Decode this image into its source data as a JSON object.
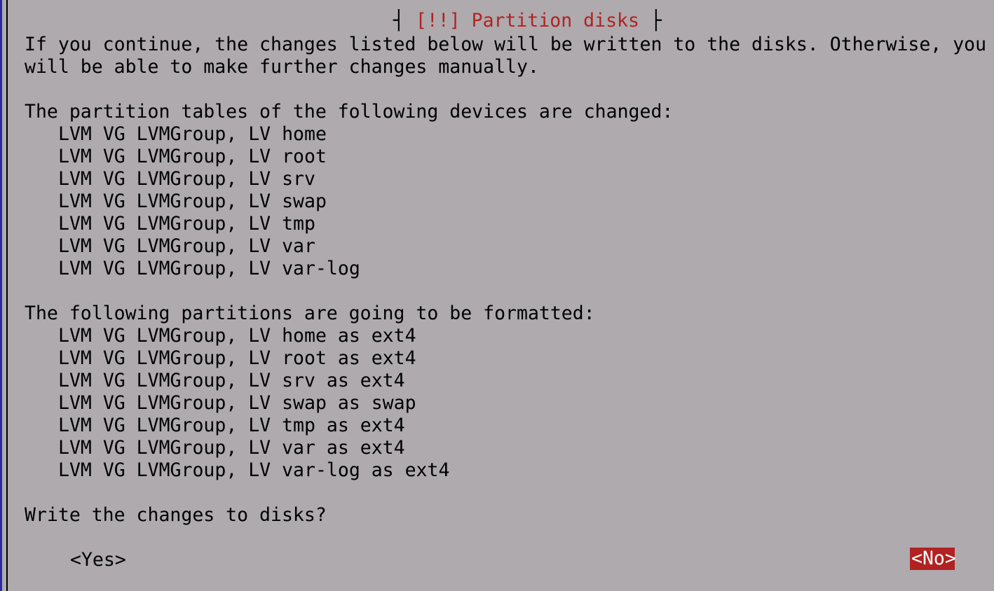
{
  "dialog": {
    "title": "[!!] Partition disks",
    "intro_line1": "If you continue, the changes listed below will be written to the disks. Otherwise, you",
    "intro_line2": "will be able to make further changes manually.",
    "changed_heading": "The partition tables of the following devices are changed:",
    "changed_devices": [
      "LVM VG LVMGroup, LV home",
      "LVM VG LVMGroup, LV root",
      "LVM VG LVMGroup, LV srv",
      "LVM VG LVMGroup, LV swap",
      "LVM VG LVMGroup, LV tmp",
      "LVM VG LVMGroup, LV var",
      "LVM VG LVMGroup, LV var-log"
    ],
    "formatted_heading": "The following partitions are going to be formatted:",
    "formatted_partitions": [
      "LVM VG LVMGroup, LV home as ext4",
      "LVM VG LVMGroup, LV root as ext4",
      "LVM VG LVMGroup, LV srv as ext4",
      "LVM VG LVMGroup, LV swap as swap",
      "LVM VG LVMGroup, LV tmp as ext4",
      "LVM VG LVMGroup, LV var as ext4",
      "LVM VG LVMGroup, LV var-log as ext4"
    ],
    "question": "Write the changes to disks?",
    "yes_label": "<Yes>",
    "no_label": "<No>"
  },
  "colors": {
    "background": "#aeaaae",
    "accent": "#b22222",
    "frame": "#2a2aa8"
  }
}
